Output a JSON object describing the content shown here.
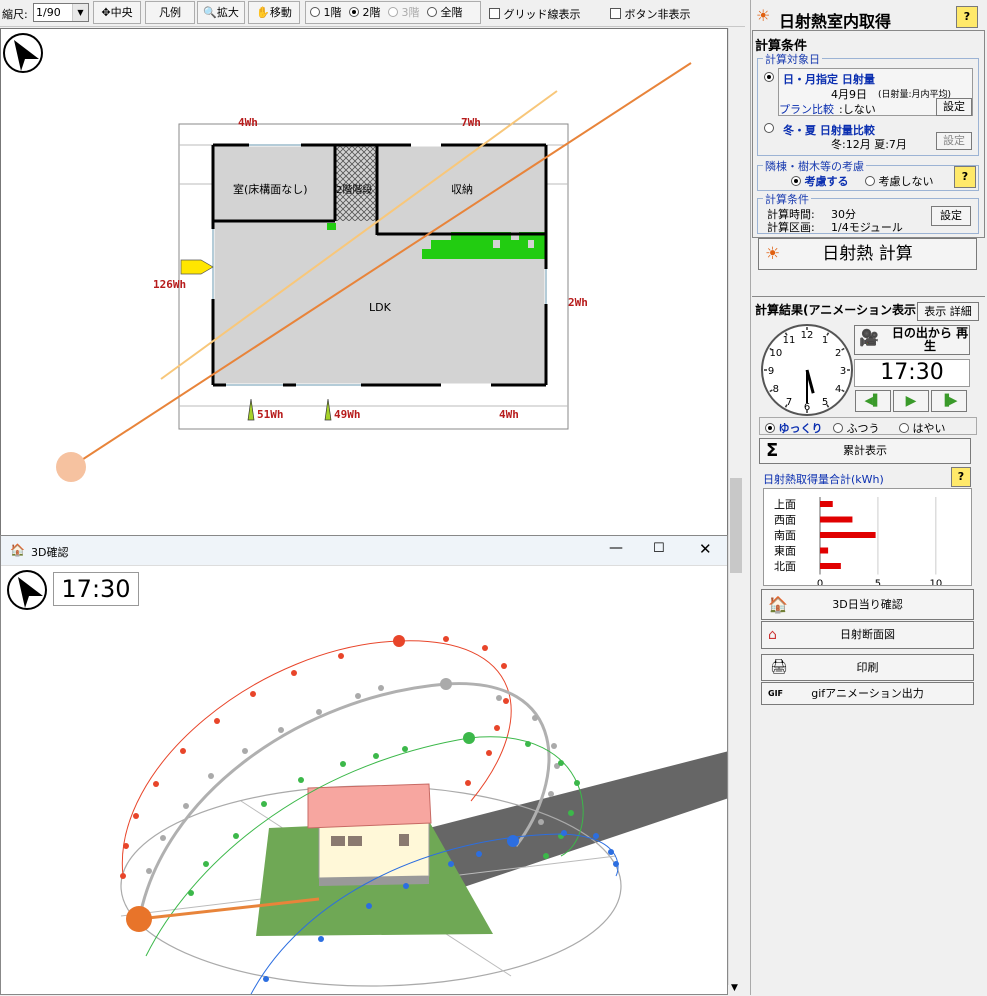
{
  "toolbar": {
    "scale_label": "縮尺:",
    "scale_value": "1/90",
    "center_label": "中央",
    "legend_label": "凡例",
    "zoom_label": "拡大",
    "move_label": "移動",
    "floor1_label": "1階",
    "floor2_label": "2階",
    "floor3_label": "3階",
    "floor_all_label": "全階",
    "grid_label": "グリッド線表示",
    "hide_buttons_label": "ボタン非表示"
  },
  "plan": {
    "rooms": {
      "room1": "室(床構面なし)",
      "stair": "2階階段",
      "storage": "収納",
      "ldk": "LDK"
    },
    "wh": {
      "top_left": "4Wh",
      "top_right": "7Wh",
      "left": "126Wh",
      "right": "2Wh",
      "bottom1": "51Wh",
      "bottom2": "49Wh",
      "bottom3": "4Wh"
    }
  },
  "panel": {
    "title": "日射熱室内取得",
    "help": "?",
    "calc_conditions": "計算条件",
    "target_day_group": "計算対象日",
    "option1_title": "日・月指定 日射量",
    "option1_date": "4月9日",
    "option1_note": "(日射量:月内平均)",
    "plan_compare": "プラン比較",
    "plan_compare_value": ":しない",
    "settings_label": "設定",
    "option2_title": "冬・夏 日射量比較",
    "option2_detail": "冬:12月 夏:7月",
    "shading_group": "隣棟・樹木等の考慮",
    "shading_on": "考慮する",
    "shading_off": "考慮しない",
    "calc_group": "計算条件",
    "calc_time": "計算時間:",
    "calc_time_value": "30分",
    "calc_section": "計算区画:",
    "calc_section_value": "1/4モジュール",
    "calc_button": "日射熱 計算",
    "results_title": "計算結果(アニメーション表示)",
    "results_detail": "表示 詳細",
    "sunrise_button": "日の出から 再生",
    "time_display": "17:30",
    "speed_slow": "ゆっくり",
    "speed_normal": "ふつう",
    "speed_fast": "はやい",
    "cumulative_button": "累計表示",
    "total_label": "日射熱取得量合計(kWh)",
    "btn_3d": "3D日当り確認",
    "btn_section": "日射断面図",
    "btn_print": "印刷",
    "btn_gif": "gifアニメーション出力",
    "gif_icon_text": "GIF"
  },
  "chart_data": {
    "type": "bar",
    "categories": [
      "上面",
      "西面",
      "南面",
      "東面",
      "北面"
    ],
    "values": [
      1.1,
      2.8,
      4.8,
      0.7,
      1.8
    ],
    "xlim": [
      0,
      12
    ],
    "xticks": [
      0,
      5,
      10
    ],
    "orientation": "horizontal",
    "bar_color": "#e00000",
    "title": "日射熱取得量合計(kWh)",
    "xlabel": "",
    "ylabel": ""
  },
  "window3d": {
    "title": "3D確認",
    "time": "17:30"
  },
  "clock": {
    "hour": 5,
    "minute": 30,
    "numbers": [
      "12",
      "1",
      "2",
      "3",
      "4",
      "5",
      "6",
      "7",
      "8",
      "9",
      "10",
      "11"
    ]
  },
  "colors": {
    "accent_blue": "#0b2fb0",
    "red_value": "#b71c1c",
    "sun_line": "#e8843a",
    "green_area": "#22cc11"
  }
}
